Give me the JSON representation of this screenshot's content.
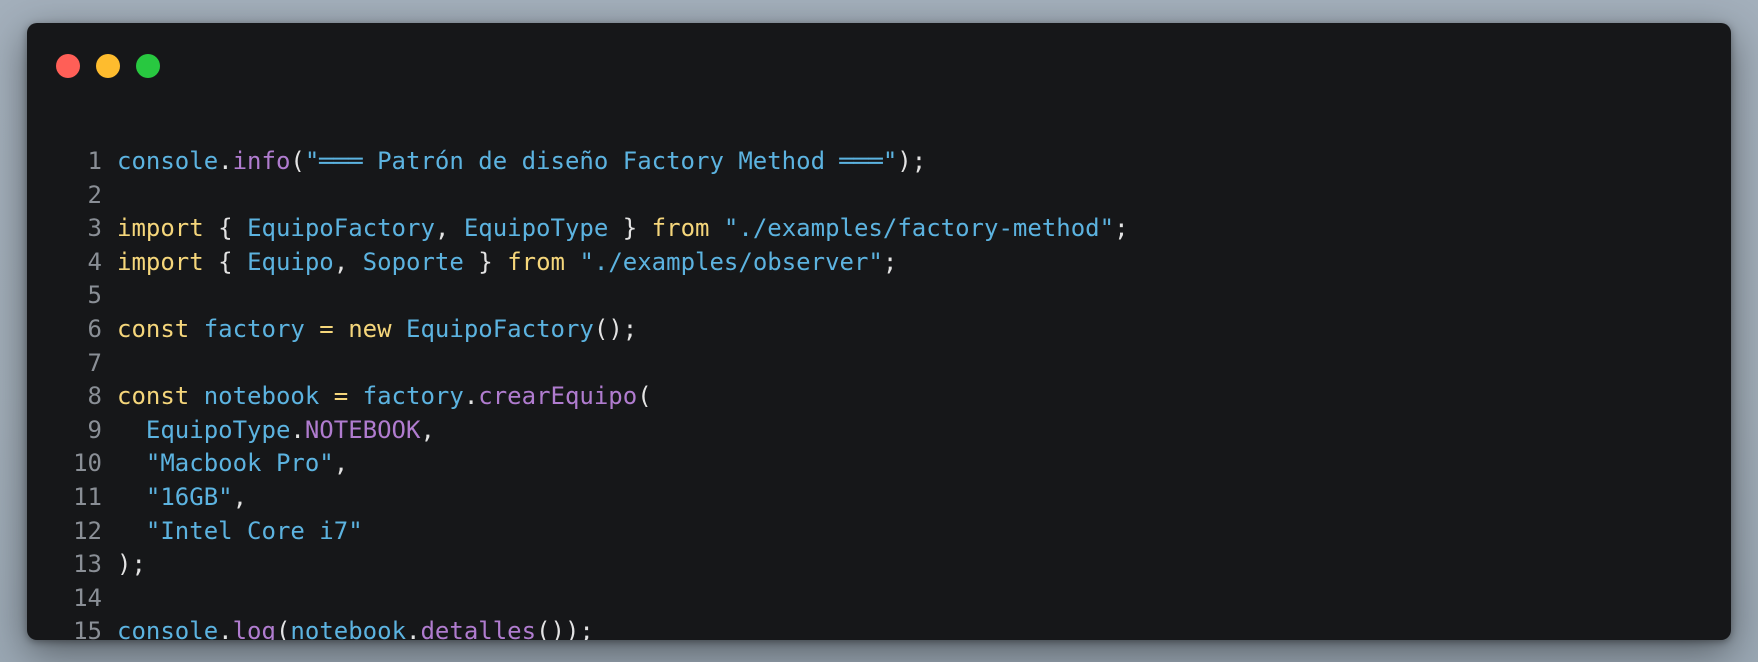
{
  "window": {
    "controls": [
      {
        "name": "close",
        "color": "#ff5f57"
      },
      {
        "name": "minimize",
        "color": "#febc2e"
      },
      {
        "name": "maximize",
        "color": "#28c840"
      }
    ]
  },
  "colors": {
    "background": "#a1adb8",
    "editor": "#161719",
    "keyword": "#f5d67b",
    "identifier": "#5cb3e0",
    "method": "#b07ccf",
    "string": "#5cb3e0",
    "punctuation": "#e3e3e3",
    "line_number": "#8a8f96"
  },
  "editor": {
    "lines": [
      {
        "num": "1",
        "tokens": [
          {
            "t": "console",
            "c": "id"
          },
          {
            "t": ".",
            "c": "punc"
          },
          {
            "t": "info",
            "c": "fn"
          },
          {
            "t": "(",
            "c": "punc"
          },
          {
            "t": "\"═══ Patrón de diseño Factory Method ═══\"",
            "c": "str"
          },
          {
            "t": ");",
            "c": "punc"
          }
        ]
      },
      {
        "num": "2",
        "tokens": []
      },
      {
        "num": "3",
        "tokens": [
          {
            "t": "import",
            "c": "kw"
          },
          {
            "t": " { ",
            "c": "punc"
          },
          {
            "t": "EquipoFactory",
            "c": "id"
          },
          {
            "t": ", ",
            "c": "punc"
          },
          {
            "t": "EquipoType",
            "c": "id"
          },
          {
            "t": " } ",
            "c": "punc"
          },
          {
            "t": "from",
            "c": "kw"
          },
          {
            "t": " ",
            "c": "punc"
          },
          {
            "t": "\"./examples/factory-method\"",
            "c": "str"
          },
          {
            "t": ";",
            "c": "punc"
          }
        ]
      },
      {
        "num": "4",
        "tokens": [
          {
            "t": "import",
            "c": "kw"
          },
          {
            "t": " { ",
            "c": "punc"
          },
          {
            "t": "Equipo",
            "c": "id"
          },
          {
            "t": ", ",
            "c": "punc"
          },
          {
            "t": "Soporte",
            "c": "id"
          },
          {
            "t": " } ",
            "c": "punc"
          },
          {
            "t": "from",
            "c": "kw"
          },
          {
            "t": " ",
            "c": "punc"
          },
          {
            "t": "\"./examples/observer\"",
            "c": "str"
          },
          {
            "t": ";",
            "c": "punc"
          }
        ]
      },
      {
        "num": "5",
        "tokens": []
      },
      {
        "num": "6",
        "tokens": [
          {
            "t": "const",
            "c": "kw"
          },
          {
            "t": " ",
            "c": "punc"
          },
          {
            "t": "factory",
            "c": "id"
          },
          {
            "t": " = ",
            "c": "kw"
          },
          {
            "t": "new",
            "c": "kw"
          },
          {
            "t": " ",
            "c": "punc"
          },
          {
            "t": "EquipoFactory",
            "c": "id"
          },
          {
            "t": "();",
            "c": "punc"
          }
        ]
      },
      {
        "num": "7",
        "tokens": []
      },
      {
        "num": "8",
        "tokens": [
          {
            "t": "const",
            "c": "kw"
          },
          {
            "t": " ",
            "c": "punc"
          },
          {
            "t": "notebook",
            "c": "id"
          },
          {
            "t": " = ",
            "c": "kw"
          },
          {
            "t": "factory",
            "c": "id"
          },
          {
            "t": ".",
            "c": "punc"
          },
          {
            "t": "crearEquipo",
            "c": "fn"
          },
          {
            "t": "(",
            "c": "punc"
          }
        ]
      },
      {
        "num": "9",
        "tokens": [
          {
            "t": "  ",
            "c": "punc"
          },
          {
            "t": "EquipoType",
            "c": "id"
          },
          {
            "t": ".",
            "c": "punc"
          },
          {
            "t": "NOTEBOOK",
            "c": "fn"
          },
          {
            "t": ",",
            "c": "punc"
          }
        ]
      },
      {
        "num": "10",
        "tokens": [
          {
            "t": "  ",
            "c": "punc"
          },
          {
            "t": "\"Macbook Pro\"",
            "c": "str"
          },
          {
            "t": ",",
            "c": "punc"
          }
        ]
      },
      {
        "num": "11",
        "tokens": [
          {
            "t": "  ",
            "c": "punc"
          },
          {
            "t": "\"16GB\"",
            "c": "str"
          },
          {
            "t": ",",
            "c": "punc"
          }
        ]
      },
      {
        "num": "12",
        "tokens": [
          {
            "t": "  ",
            "c": "punc"
          },
          {
            "t": "\"Intel Core i7\"",
            "c": "str"
          }
        ]
      },
      {
        "num": "13",
        "tokens": [
          {
            "t": ");",
            "c": "punc"
          }
        ]
      },
      {
        "num": "14",
        "tokens": []
      },
      {
        "num": "15",
        "tokens": [
          {
            "t": "console",
            "c": "id"
          },
          {
            "t": ".",
            "c": "punc"
          },
          {
            "t": "log",
            "c": "fn"
          },
          {
            "t": "(",
            "c": "punc"
          },
          {
            "t": "notebook",
            "c": "id"
          },
          {
            "t": ".",
            "c": "punc"
          },
          {
            "t": "detalles",
            "c": "fn"
          },
          {
            "t": "());",
            "c": "punc"
          }
        ]
      }
    ]
  }
}
